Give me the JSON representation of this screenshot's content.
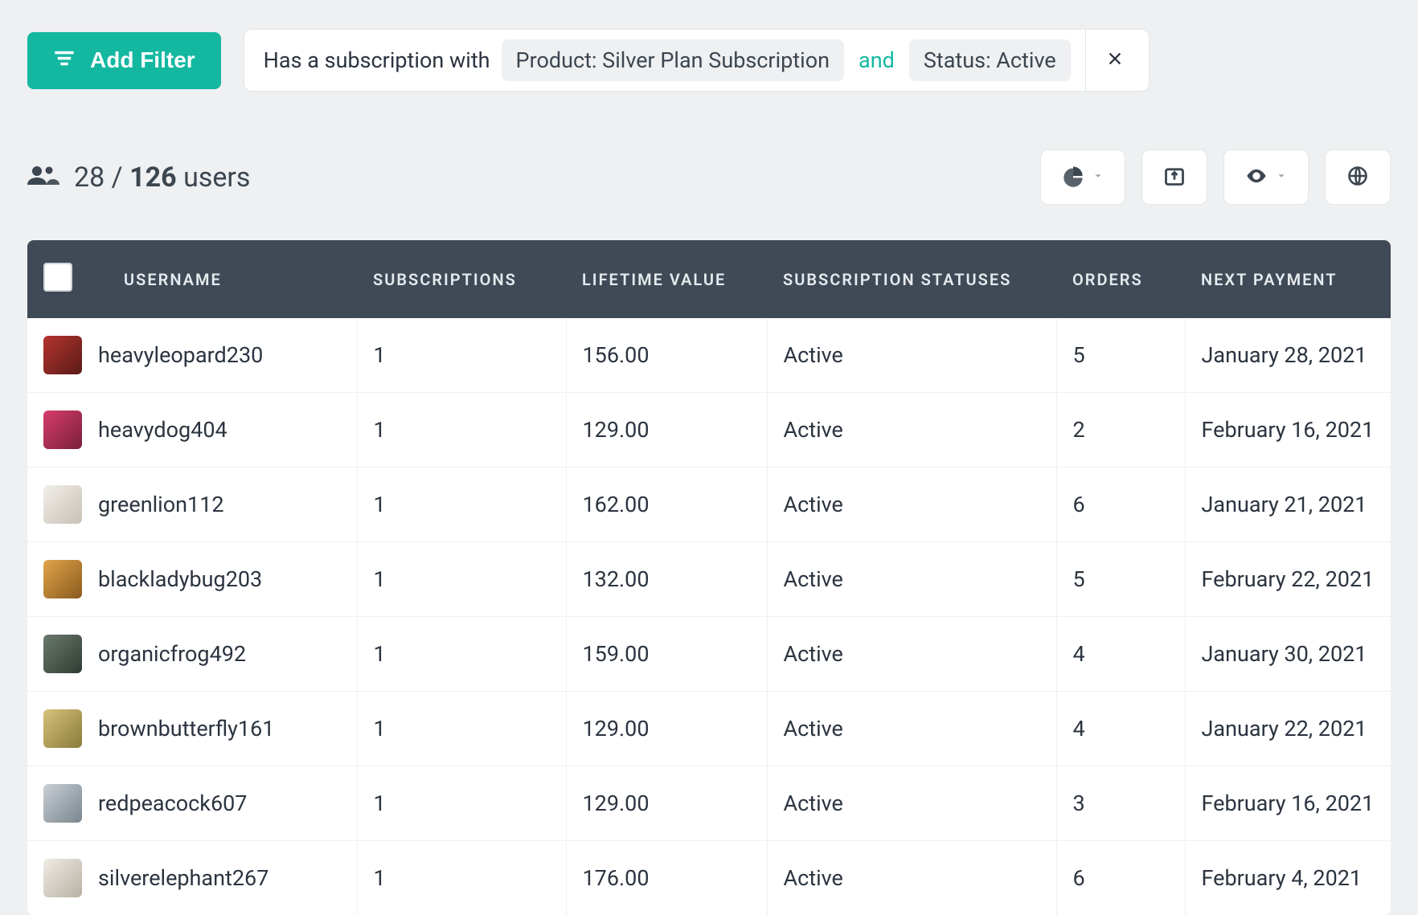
{
  "filterBar": {
    "addFilterLabel": "Add Filter",
    "prefix": "Has a subscription with",
    "chipProduct": "Product: Silver Plan Subscription",
    "and": "and",
    "chipStatus": "Status: Active"
  },
  "summary": {
    "shown": "28",
    "sep": " / ",
    "total": "126",
    "unit": " users"
  },
  "columns": {
    "username": "USERNAME",
    "subscriptions": "SUBSCRIPTIONS",
    "lifetime": "LIFETIME VALUE",
    "statuses": "SUBSCRIPTION STATUSES",
    "orders": "ORDERS",
    "next": "NEXT PAYMENT"
  },
  "rows": [
    {
      "username": "heavyleopard230",
      "subscriptions": "1",
      "lifetime": "156.00",
      "status": "Active",
      "orders": "5",
      "next": "January 28, 2021"
    },
    {
      "username": "heavydog404",
      "subscriptions": "1",
      "lifetime": "129.00",
      "status": "Active",
      "orders": "2",
      "next": "February 16, 2021"
    },
    {
      "username": "greenlion112",
      "subscriptions": "1",
      "lifetime": "162.00",
      "status": "Active",
      "orders": "6",
      "next": "January 21, 2021"
    },
    {
      "username": "blackladybug203",
      "subscriptions": "1",
      "lifetime": "132.00",
      "status": "Active",
      "orders": "5",
      "next": "February 22, 2021"
    },
    {
      "username": "organicfrog492",
      "subscriptions": "1",
      "lifetime": "159.00",
      "status": "Active",
      "orders": "4",
      "next": "January 30, 2021"
    },
    {
      "username": "brownbutterfly161",
      "subscriptions": "1",
      "lifetime": "129.00",
      "status": "Active",
      "orders": "4",
      "next": "January 22, 2021"
    },
    {
      "username": "redpeacock607",
      "subscriptions": "1",
      "lifetime": "129.00",
      "status": "Active",
      "orders": "3",
      "next": "February 16, 2021"
    },
    {
      "username": "silverelephant267",
      "subscriptions": "1",
      "lifetime": "176.00",
      "status": "Active",
      "orders": "6",
      "next": "February 4, 2021"
    }
  ]
}
